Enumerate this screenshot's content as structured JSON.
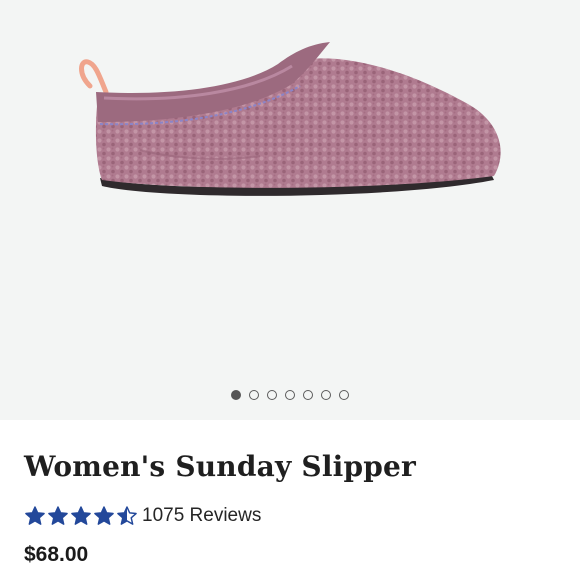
{
  "product": {
    "title": "Women's Sunday Slipper",
    "price": "$68.00",
    "image_icon": "slipper-image",
    "image_color": "#b07b90"
  },
  "gallery": {
    "image_count": 7,
    "active_index": 0
  },
  "rating": {
    "value": 4.5,
    "max": 5,
    "star_color": "#23489a",
    "reviews_label": "1075 Reviews"
  }
}
